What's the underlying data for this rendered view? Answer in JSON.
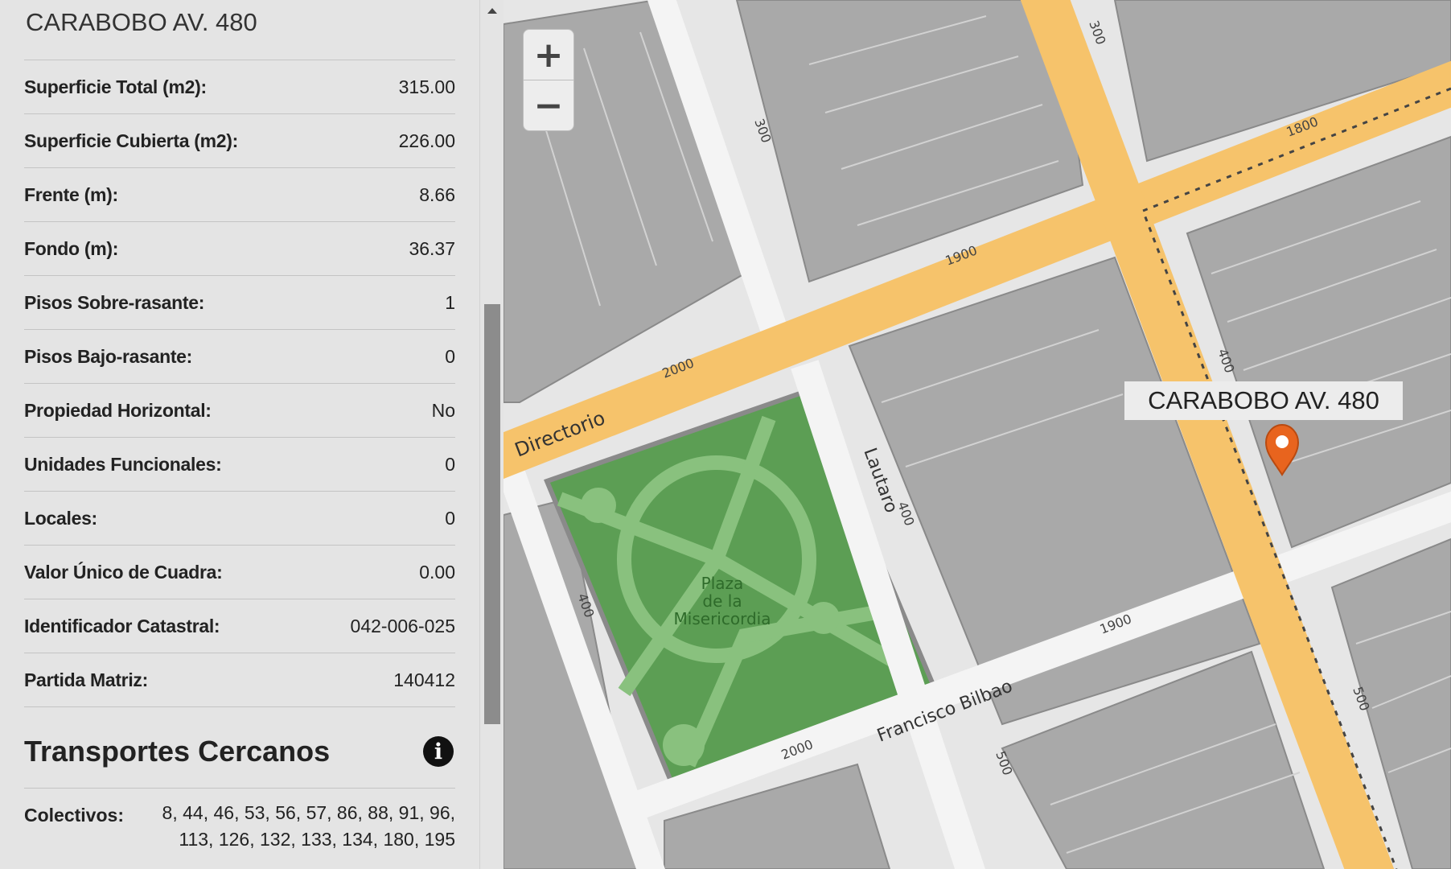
{
  "parcel": {
    "title": "CARABOBO AV. 480",
    "rows": [
      {
        "label": "Superficie Total (m2):",
        "value": "315.00"
      },
      {
        "label": "Superficie Cubierta (m2):",
        "value": "226.00"
      },
      {
        "label": "Frente (m):",
        "value": "8.66"
      },
      {
        "label": "Fondo (m):",
        "value": "36.37"
      },
      {
        "label": "Pisos Sobre-rasante:",
        "value": "1"
      },
      {
        "label": "Pisos Bajo-rasante:",
        "value": "0"
      },
      {
        "label": "Propiedad Horizontal:",
        "value": "No"
      },
      {
        "label": "Unidades Funcionales:",
        "value": "0"
      },
      {
        "label": "Locales:",
        "value": "0"
      },
      {
        "label": "Valor Único de Cuadra:",
        "value": "0.00"
      },
      {
        "label": "Identificador Catastral:",
        "value": "042-006-025"
      },
      {
        "label": "Partida Matriz:",
        "value": "140412"
      }
    ]
  },
  "transport": {
    "title": "Transportes Cercanos",
    "info_icon": "info-icon",
    "label": "Colectivos:",
    "value": "8, 44, 46, 53, 56, 57, 86, 88, 91, 96, 113, 126, 132, 133, 134, 180, 195"
  },
  "map": {
    "zoom_in": "+",
    "zoom_out": "−",
    "marker_label": "CARABOBO AV. 480",
    "streets": {
      "directorio": "Directorio",
      "lautaro": "Lautaro",
      "bilbao": "Francisco Bilbao"
    },
    "park": [
      "Plaza",
      "de la",
      "Misericordia"
    ],
    "numbers": {
      "n300a": "300",
      "n300b": "300",
      "n1800": "1800",
      "n1900a": "1900",
      "n2000a": "2000",
      "n400a": "400",
      "n400b": "400",
      "n400c": "400",
      "n1900b": "1900",
      "n2000b": "2000",
      "n500a": "500",
      "n500b": "500"
    },
    "colors": {
      "land": "#e6e6e6",
      "block": "#a9a9a9",
      "lot": "#bfbfbf",
      "avenue": "#f6c36b",
      "park": "#5c9e54",
      "path": "#89c17e",
      "marker": "#e8641e"
    },
    "marker_icon": "map-pin-icon"
  }
}
